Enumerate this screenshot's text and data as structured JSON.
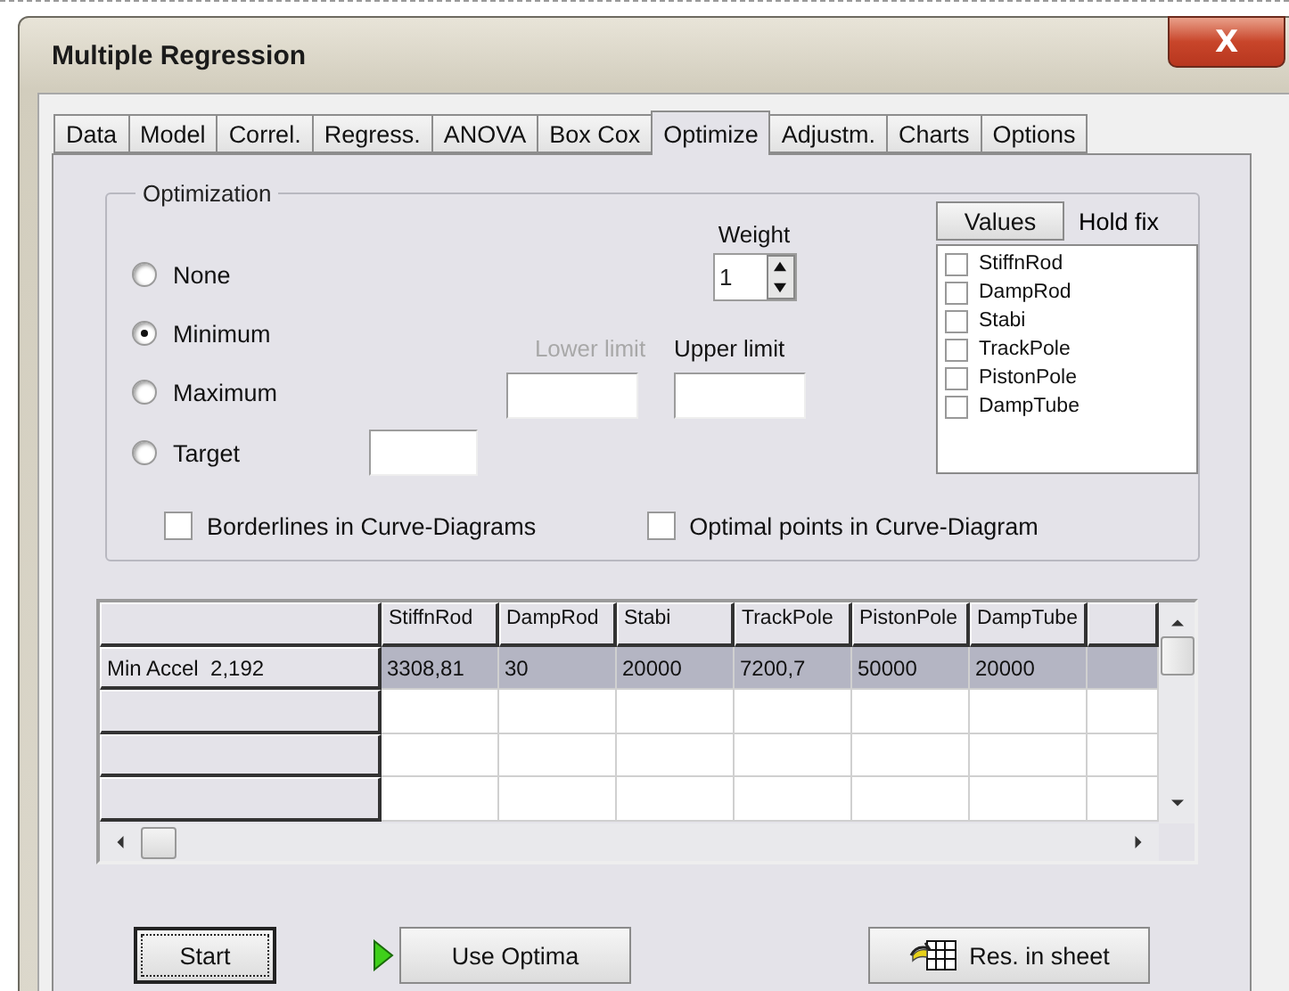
{
  "window": {
    "title": "Multiple Regression",
    "close": "X"
  },
  "tabs": [
    {
      "label": "Data",
      "selected": false
    },
    {
      "label": "Model",
      "selected": false
    },
    {
      "label": "Correl.",
      "selected": false
    },
    {
      "label": "Regress.",
      "selected": false
    },
    {
      "label": "ANOVA",
      "selected": false
    },
    {
      "label": "Box Cox",
      "selected": false
    },
    {
      "label": "Optimize",
      "selected": true
    },
    {
      "label": "Adjustm.",
      "selected": false
    },
    {
      "label": "Charts",
      "selected": false
    },
    {
      "label": "Options",
      "selected": false
    }
  ],
  "optimization": {
    "title": "Optimization",
    "modes": [
      {
        "label": "None",
        "selected": false
      },
      {
        "label": "Minimum",
        "selected": true
      },
      {
        "label": "Maximum",
        "selected": false
      },
      {
        "label": "Target",
        "selected": false
      }
    ],
    "weight": {
      "label": "Weight",
      "value": "1"
    },
    "lower_limit": {
      "label": "Lower limit",
      "disabled": true
    },
    "upper_limit": {
      "label": "Upper limit",
      "disabled": false
    },
    "values_button": "Values",
    "hold_fix_label": "Hold fix",
    "hold_fix": [
      {
        "label": "StiffnRod",
        "checked": false
      },
      {
        "label": "DampRod",
        "checked": false
      },
      {
        "label": "Stabi",
        "checked": false
      },
      {
        "label": "TrackPole",
        "checked": false
      },
      {
        "label": "PistonPole",
        "checked": false
      },
      {
        "label": "DampTube",
        "checked": false
      }
    ],
    "options": [
      {
        "label": "Borderlines in Curve-Diagrams",
        "checked": false
      },
      {
        "label": "Optimal points in Curve-Diagram",
        "checked": false
      }
    ]
  },
  "table": {
    "columns": [
      "StiffnRod",
      "DampRod",
      "Stabi",
      "TrackPole",
      "PistonPole",
      "DampTube"
    ],
    "rows": [
      {
        "header": "Min Accel  2,192",
        "cells": [
          "3308,81",
          "30",
          "20000",
          "7200,7",
          "50000",
          "20000"
        ],
        "selected": true
      },
      {
        "selected": false
      },
      {
        "selected": false
      },
      {
        "selected": false
      }
    ]
  },
  "buttons": [
    {
      "label": "Start",
      "kind": "default"
    },
    {
      "label": "Use Optima",
      "kind": "play"
    },
    {
      "label": "Res. in sheet",
      "kind": "sheet"
    }
  ]
}
